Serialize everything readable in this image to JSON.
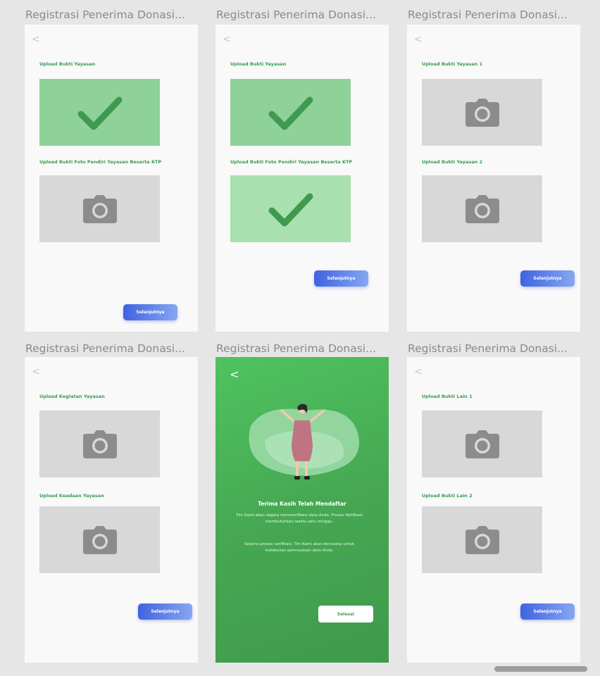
{
  "artboard_title": "Registrasi Penerima Donasi...",
  "back_glyph": "<",
  "next_label": "Selanjutnya",
  "colors": {
    "canvas": "#e6e6e6",
    "screen": "#f9f9f9",
    "label_green": "#3a9a52",
    "upload_empty": "#d8d8d8",
    "upload_done": "#8ed29a",
    "check": "#3f9a50",
    "button_gradient_start": "#3f63e0",
    "button_gradient_end": "#86a6f2",
    "success_bg": "#46a852"
  },
  "screens": [
    {
      "labels": [
        "Upload Bukti Yayasan",
        "Upload Bukti Foto Pendiri Yayasan Beserta KTP"
      ],
      "states": [
        "done",
        "empty"
      ],
      "icons": [
        "check-icon",
        "camera-icon"
      ]
    },
    {
      "labels": [
        "Upload Bukti Yayasan",
        "Upload Bukti Foto Pendiri Yayasan Beserta KTP"
      ],
      "states": [
        "done",
        "done"
      ],
      "icons": [
        "check-icon",
        "check-icon"
      ]
    },
    {
      "labels": [
        "Upload Bukti Yayasan 1",
        "Upload Bukti Yayasan 2"
      ],
      "states": [
        "empty",
        "empty"
      ],
      "icons": [
        "camera-icon",
        "camera-icon"
      ]
    },
    {
      "labels": [
        "Upload Kegiatan Yayasan",
        "Upload Keadaan Yayasan"
      ],
      "states": [
        "empty",
        "empty"
      ],
      "icons": [
        "camera-icon",
        "camera-icon"
      ]
    },
    {
      "title": "Terima Kasih Telah Mendaftar",
      "body1": "Tim Kami akan segera memverifikasi data Anda. Proses Verifikasi membutuhkan waktu satu minggu.",
      "body2": "Selama proses verifikasi, Tim Kami akan berusaha untuk melakukan pemrosesan data Anda.",
      "done_label": "Selesai",
      "icons": [
        "woman-illustration",
        "back-icon"
      ]
    },
    {
      "labels": [
        "Upload Bukti Lain 1",
        "Upload Bukti Lain 2"
      ],
      "states": [
        "empty",
        "empty"
      ],
      "icons": [
        "camera-icon",
        "camera-icon"
      ]
    }
  ]
}
